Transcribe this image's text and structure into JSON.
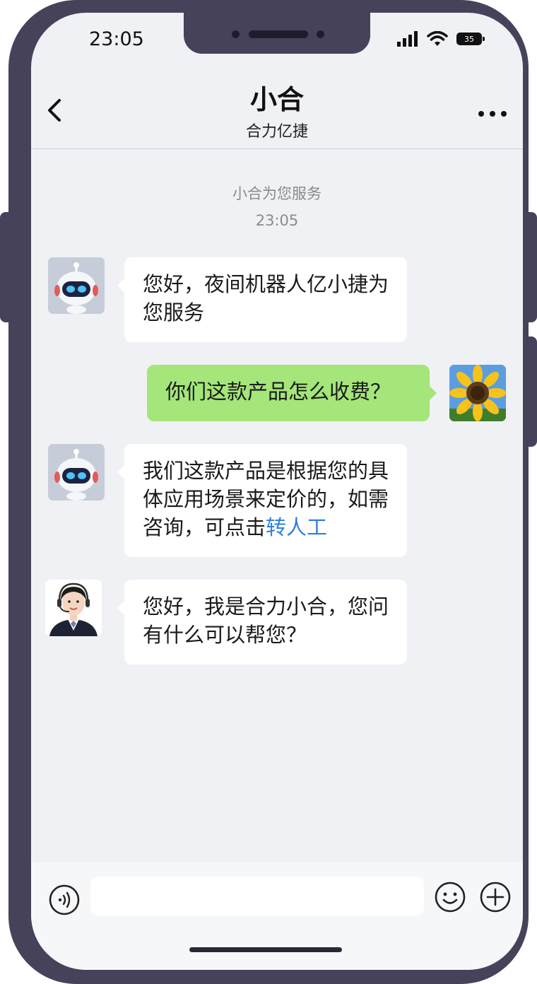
{
  "status_bar": {
    "time": "23:05",
    "battery": "35"
  },
  "header": {
    "title": "小合",
    "subtitle": "合力亿捷"
  },
  "system": {
    "service_text": "小合为您服务",
    "time": "23:05"
  },
  "messages": [
    {
      "sender": "bot",
      "avatar": "robot-avatar",
      "text": "您好，夜间机器人亿小捷为您服务"
    },
    {
      "sender": "user",
      "avatar": "sunflower-avatar",
      "text": "你们这款产品怎么收费？"
    },
    {
      "sender": "bot",
      "avatar": "robot-avatar",
      "text_before_link": "我们这款产品是根据您的具体应用场景来定价的，如需咨询，可点击",
      "link": "转人工"
    },
    {
      "sender": "agent",
      "avatar": "agent-avatar",
      "text": "您好，我是合力小合，您问有什么可以帮您？"
    }
  ],
  "input": {
    "placeholder": ""
  },
  "colors": {
    "frame": "#45425a",
    "user_bubble": "#a4e67a",
    "link": "#2f7fe0",
    "background": "#f0f1f5"
  }
}
